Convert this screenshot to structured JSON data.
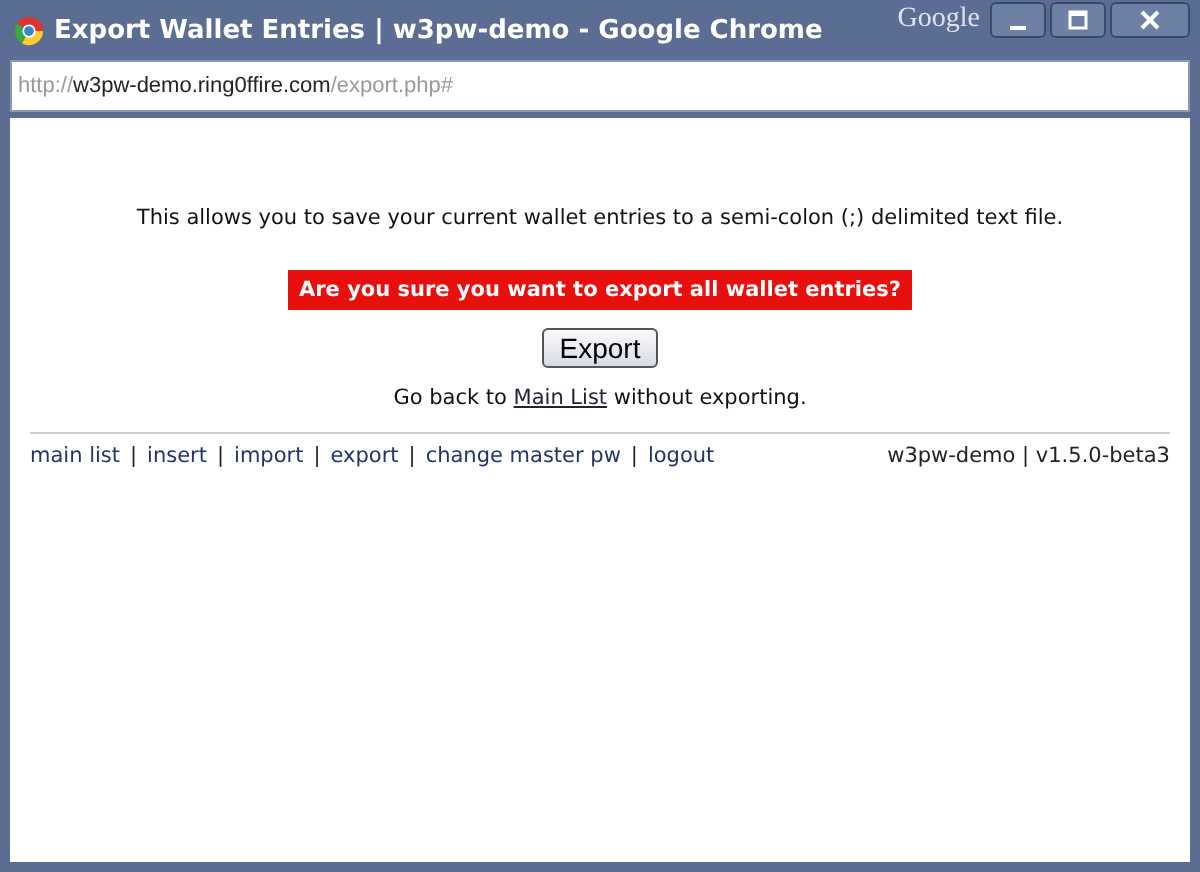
{
  "window": {
    "title": "Export Wallet Entries | w3pw-demo - Google Chrome",
    "brand": "Google"
  },
  "address_bar": {
    "scheme": "http://",
    "host": "w3pw-demo.ring0ffire.com",
    "path": "/export.php#"
  },
  "intro": "This allows you to save your current wallet entries to a semi-colon (;) delimited text file.",
  "warning": "Are you sure you want to export all wallet entries?",
  "export_button": "Export",
  "back_text": {
    "before": "Go back to ",
    "link": "Main List",
    "after": " without exporting."
  },
  "footer": {
    "links": [
      {
        "label": "main list"
      },
      {
        "label": "insert"
      },
      {
        "label": "import"
      },
      {
        "label": "export"
      },
      {
        "label": "change master pw"
      },
      {
        "label": "logout"
      }
    ],
    "separator": "|",
    "version": "w3pw-demo | v1.5.0-beta3"
  }
}
